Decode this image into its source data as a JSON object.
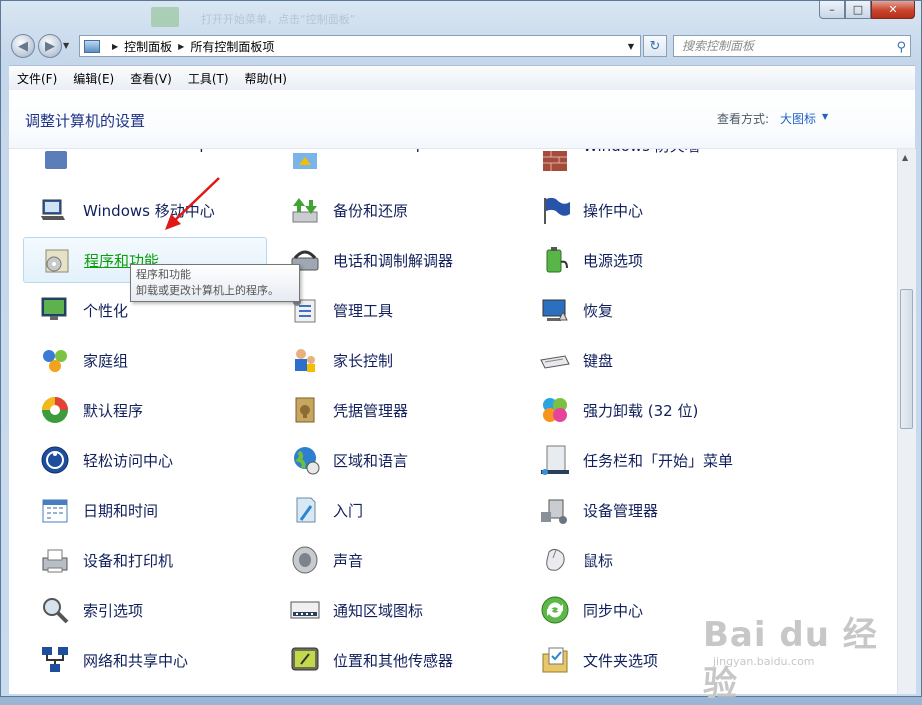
{
  "titlebar": {
    "ghost_text": "打开开始菜单，点击“控制面板”"
  },
  "window_controls": {
    "minimize": "–",
    "maximize": "□",
    "close": "✕"
  },
  "nav": {
    "breadcrumb": [
      "控制面板",
      "所有控制面板项"
    ],
    "search_placeholder": "搜索控制面板"
  },
  "menubar": [
    "文件(F)",
    "编辑(E)",
    "查看(V)",
    "工具(T)",
    "帮助(H)"
  ],
  "header": {
    "title": "调整计算机的设置",
    "view_label": "查看方式:",
    "view_value": "大图标"
  },
  "items": [
    {
      "label": "Windows CardSpace",
      "icon": "cardspace-icon",
      "state": "cut"
    },
    {
      "label": "Windows Update",
      "icon": "windows-update-icon",
      "state": "cut"
    },
    {
      "label": "Windows 防火墙",
      "icon": "firewall-icon",
      "state": "cut"
    },
    {
      "label": "Windows 移动中心",
      "icon": "mobility-center-icon"
    },
    {
      "label": "备份和还原",
      "icon": "backup-restore-icon"
    },
    {
      "label": "操作中心",
      "icon": "action-center-flag-icon"
    },
    {
      "label": "程序和功能",
      "icon": "programs-features-icon",
      "state": "hover"
    },
    {
      "label": "电话和调制解调器",
      "icon": "phone-modem-icon"
    },
    {
      "label": "电源选项",
      "icon": "power-options-icon"
    },
    {
      "label": "个性化",
      "icon": "personalization-icon"
    },
    {
      "label": "管理工具",
      "icon": "admin-tools-icon"
    },
    {
      "label": "恢复",
      "icon": "recovery-icon"
    },
    {
      "label": "家庭组",
      "icon": "homegroup-icon"
    },
    {
      "label": "家长控制",
      "icon": "parental-controls-icon"
    },
    {
      "label": "键盘",
      "icon": "keyboard-icon"
    },
    {
      "label": "默认程序",
      "icon": "default-programs-icon"
    },
    {
      "label": "凭据管理器",
      "icon": "credential-manager-icon"
    },
    {
      "label": "强力卸载 (32 位)",
      "icon": "uninstaller-clover-icon"
    },
    {
      "label": "轻松访问中心",
      "icon": "ease-of-access-icon"
    },
    {
      "label": "区域和语言",
      "icon": "region-language-globe-icon"
    },
    {
      "label": "任务栏和「开始」菜单",
      "icon": "taskbar-start-menu-icon"
    },
    {
      "label": "日期和时间",
      "icon": "date-time-icon"
    },
    {
      "label": "入门",
      "icon": "getting-started-icon"
    },
    {
      "label": "设备管理器",
      "icon": "device-manager-icon"
    },
    {
      "label": "设备和打印机",
      "icon": "devices-printers-icon"
    },
    {
      "label": "声音",
      "icon": "sound-speaker-icon"
    },
    {
      "label": "鼠标",
      "icon": "mouse-icon"
    },
    {
      "label": "索引选项",
      "icon": "indexing-options-icon"
    },
    {
      "label": "通知区域图标",
      "icon": "notification-area-icon"
    },
    {
      "label": "同步中心",
      "icon": "sync-center-icon"
    },
    {
      "label": "网络和共享中心",
      "icon": "network-sharing-icon"
    },
    {
      "label": "位置和其他传感器",
      "icon": "location-sensors-icon"
    },
    {
      "label": "文件夹选项",
      "icon": "folder-options-icon"
    }
  ],
  "tooltip": {
    "title": "程序和功能",
    "desc": "卸载或更改计算机上的程序。"
  },
  "watermark": {
    "brand": "Bai du 经验",
    "url": "jingyan.baidu.com"
  }
}
